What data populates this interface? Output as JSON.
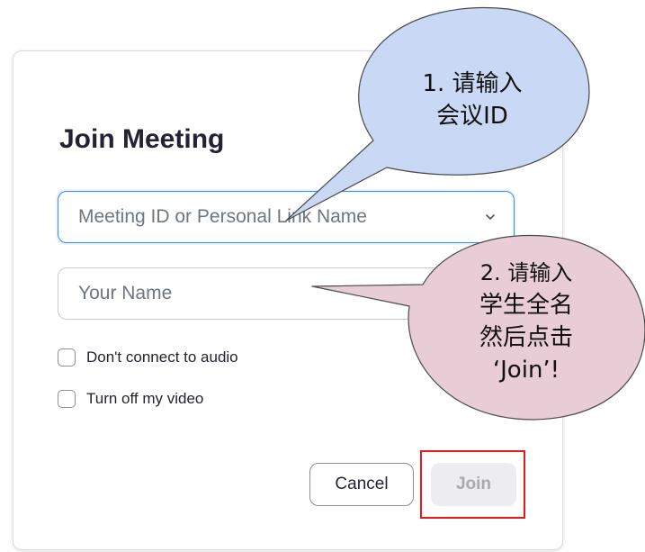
{
  "dialog": {
    "title": "Join Meeting",
    "meeting_id_field": {
      "placeholder": "Meeting ID or Personal Link Name",
      "value": ""
    },
    "name_field": {
      "placeholder": "Your Name",
      "value": ""
    },
    "options": [
      {
        "label": "Don't connect to audio",
        "checked": false
      },
      {
        "label": "Turn off my video",
        "checked": false
      }
    ],
    "cancel_label": "Cancel",
    "join_label": "Join"
  },
  "annotations": {
    "callout_1": [
      "1. 请输入",
      "会议ID"
    ],
    "callout_2": [
      "2. 请输入",
      "学生全名",
      "然后点击",
      "‘Join’!"
    ]
  },
  "colors": {
    "accent_blue": "#2d8cff",
    "callout_1_fill": "#c9d8f5",
    "callout_2_fill": "#e8cdd6",
    "highlight_red": "#e81818"
  }
}
